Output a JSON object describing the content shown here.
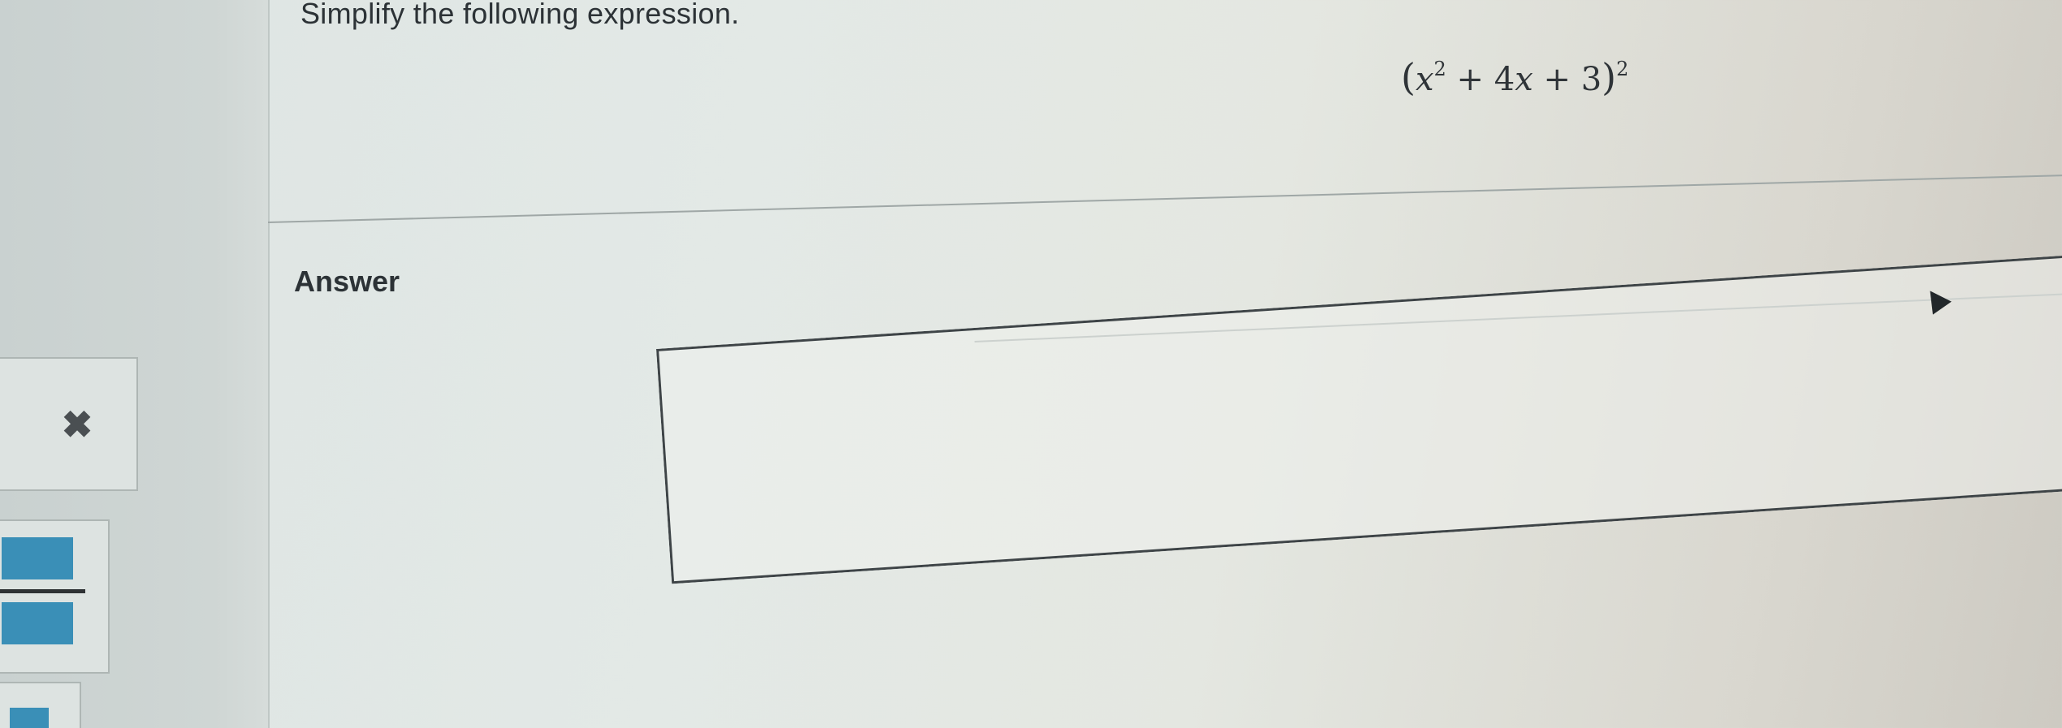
{
  "question": {
    "title": "Simplify the following expression."
  },
  "expression": {
    "open_paren": "(",
    "var1": "x",
    "exp1": "2",
    "middle": " + 4",
    "var2": "x",
    "tail": " + 3",
    "close_paren": ")",
    "outer_exp": "2"
  },
  "answer": {
    "label": "Answer",
    "value": ""
  },
  "toolbar": {
    "clear_icon_glyph": "✖"
  },
  "colors": {
    "accent": "#3a8fb7"
  }
}
